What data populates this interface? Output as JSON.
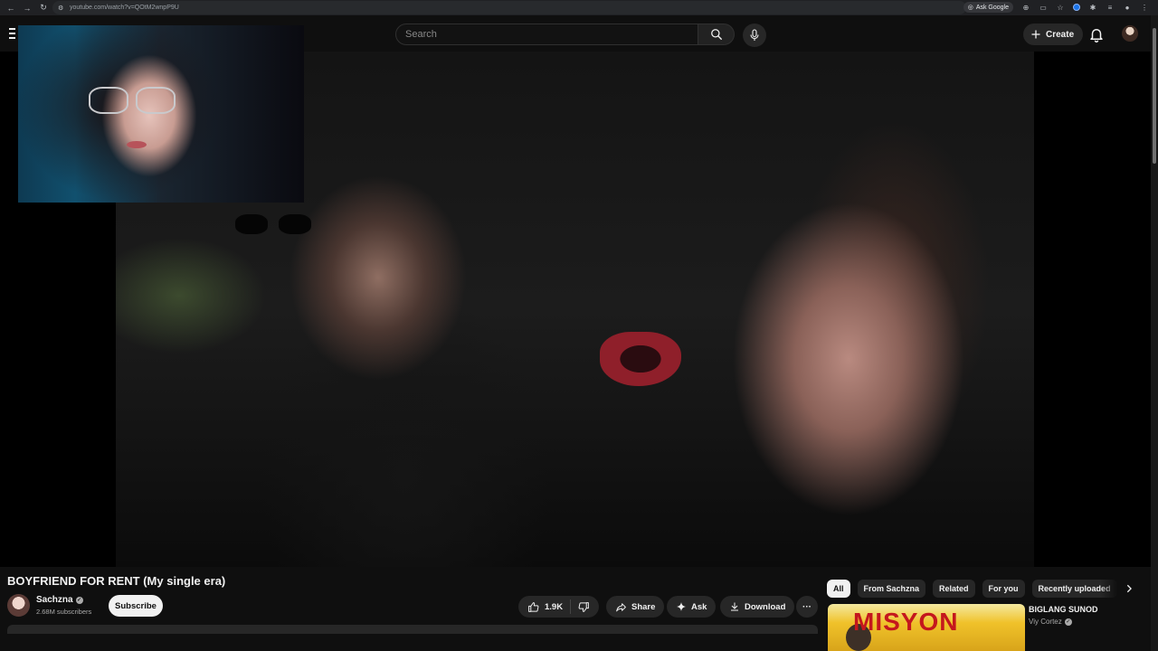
{
  "browser": {
    "url": "youtube.com/watch?v=QOtM2wnpP9U",
    "ask_google": "Ask Google"
  },
  "header": {
    "search_placeholder": "Search",
    "create_label": "Create"
  },
  "video": {
    "title": "BOYFRIEND FOR RENT (My single era)",
    "channel_name": "Sachzna",
    "subscribers": "2.68M subscribers",
    "subscribe_label": "Subscribe",
    "likes": "1.9K",
    "share_label": "Share",
    "ask_label": "Ask",
    "download_label": "Download",
    "more_label": "···"
  },
  "chips": [
    "All",
    "From Sachzna",
    "Related",
    "For you",
    "Recently uploaded"
  ],
  "recommendation": {
    "title": "BIGLANG SUNOD",
    "channel": "Viy Cortez",
    "thumb_text": "MISYON"
  },
  "colors": {
    "background": "#0f0f0f",
    "pill": "#272727",
    "accent_red": "#c4171d"
  }
}
